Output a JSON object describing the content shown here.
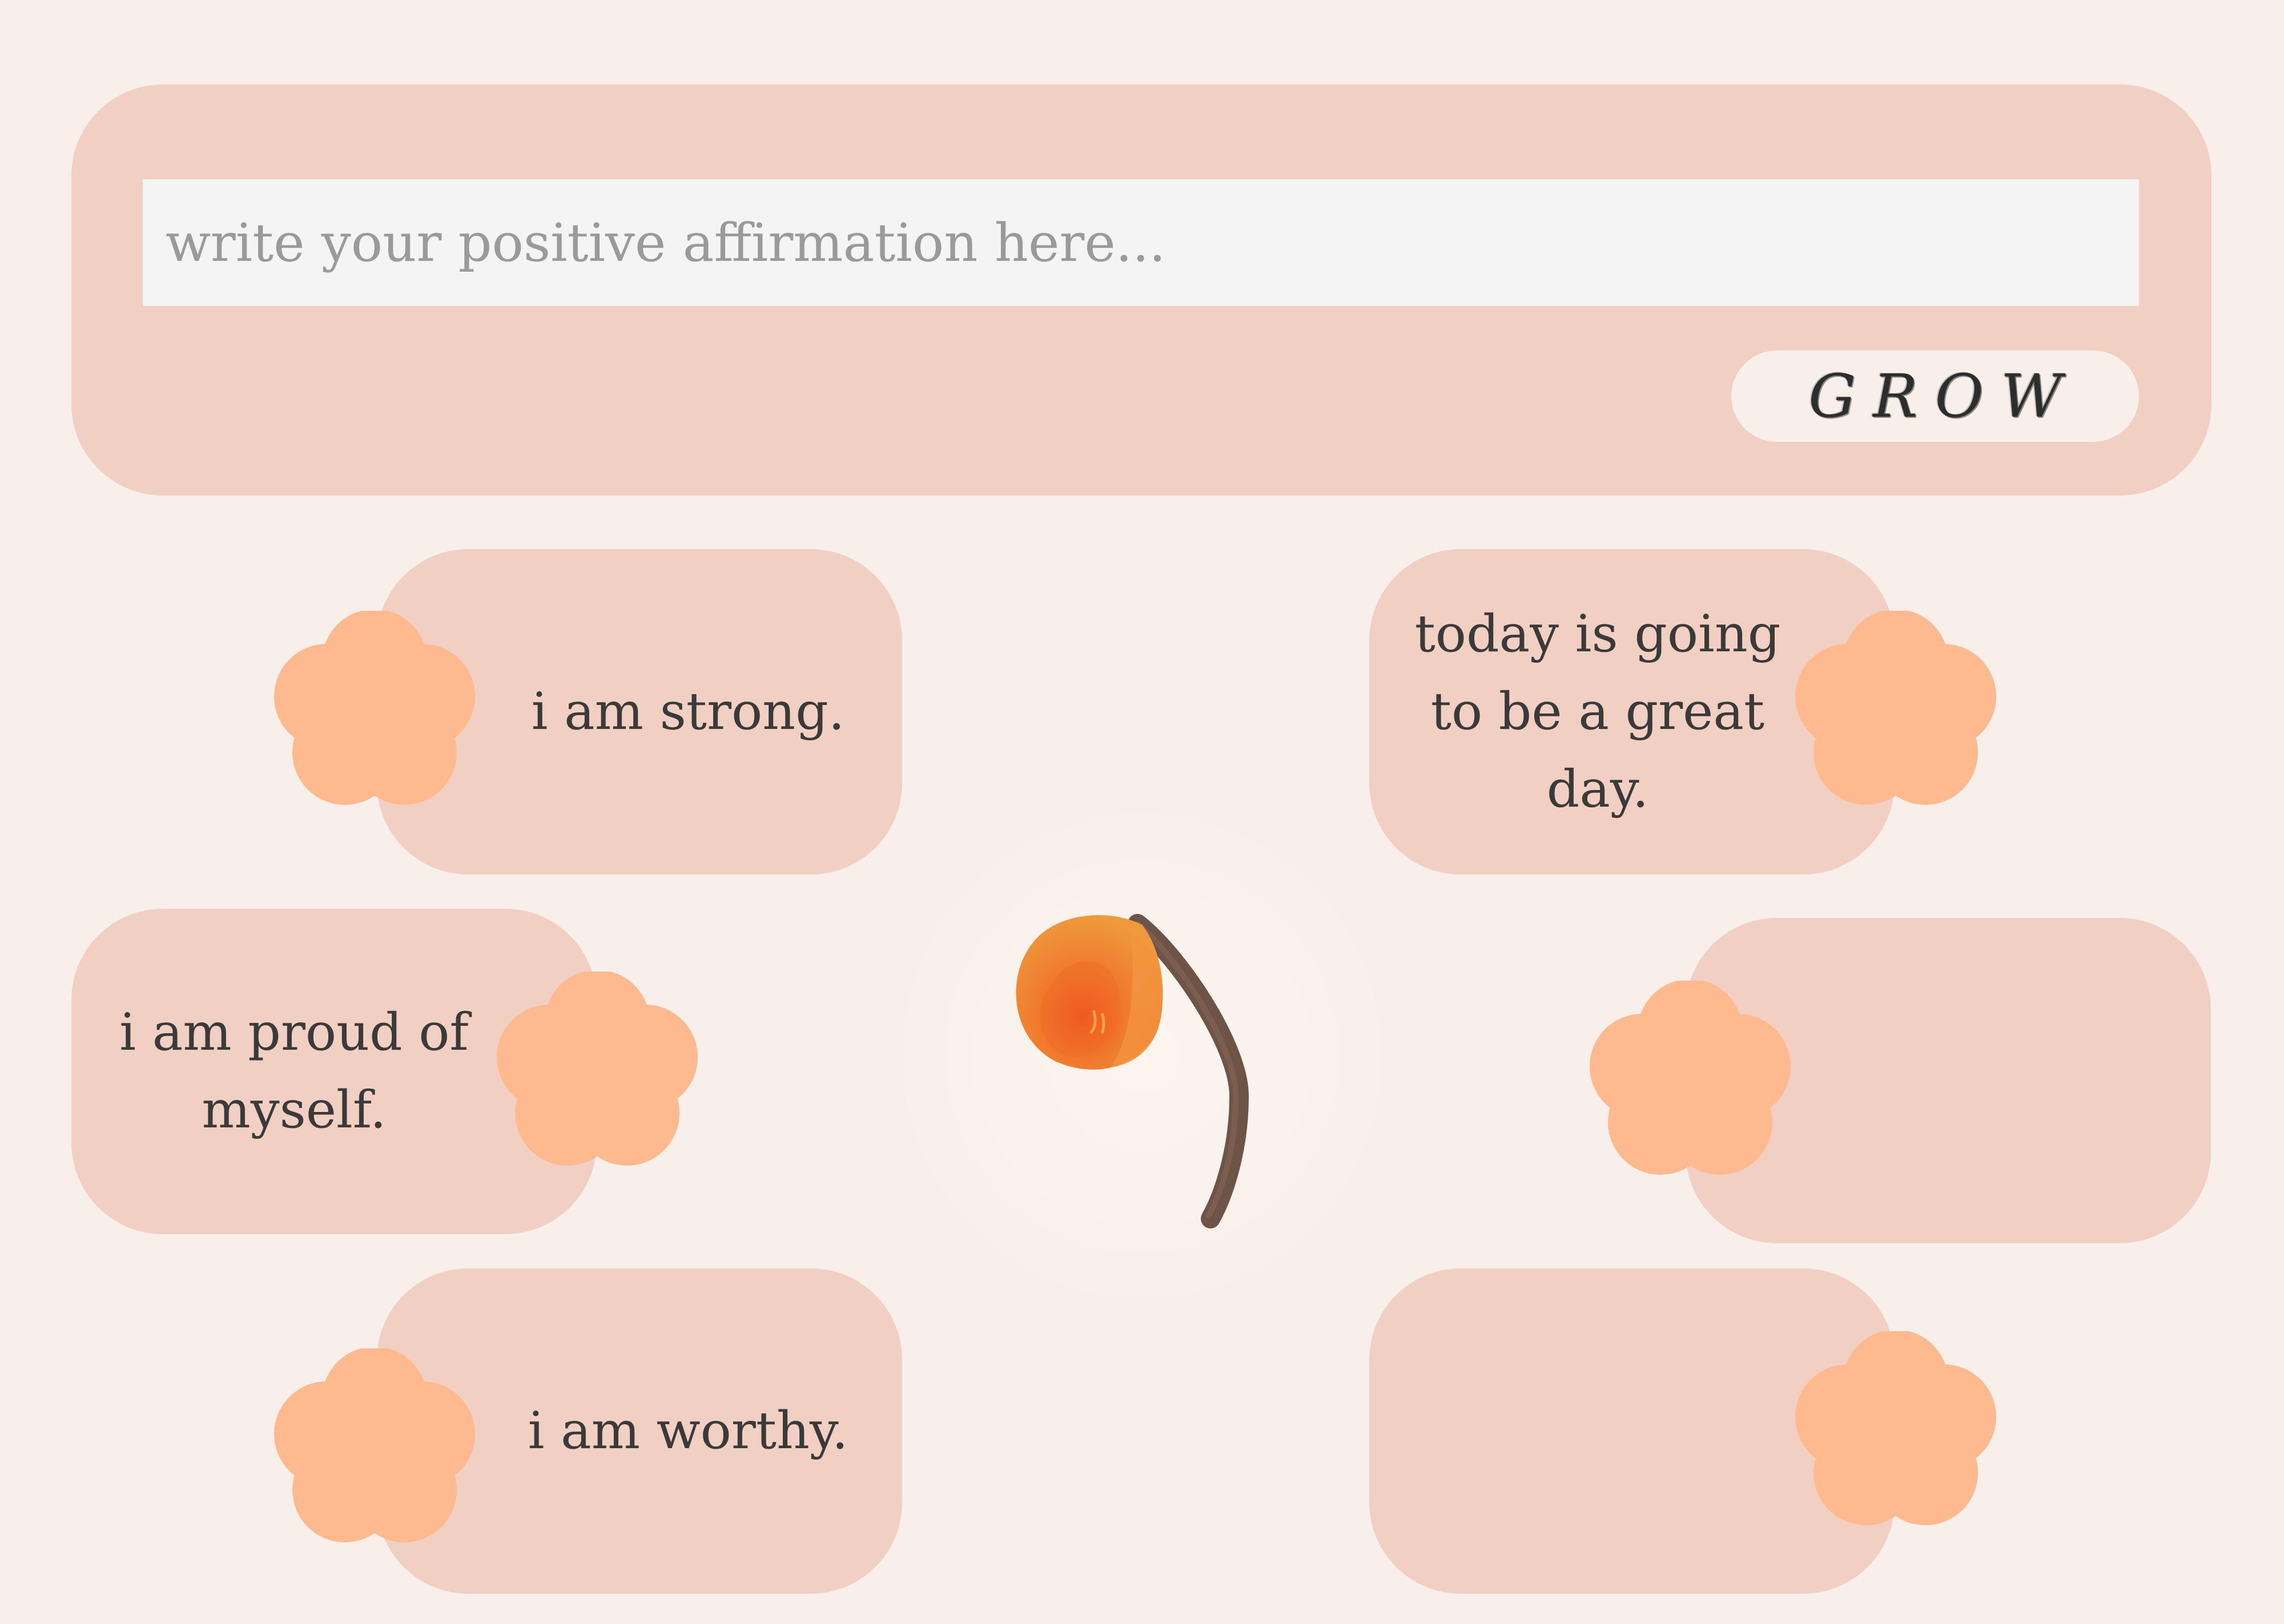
{
  "input": {
    "placeholder": "write your positive affirmation here...",
    "value": ""
  },
  "grow_button": {
    "label": "GROW"
  },
  "affirmations": [
    {
      "text": "i am strong."
    },
    {
      "text": "today is going to be a great day."
    },
    {
      "text": "i am proud of myself."
    },
    {
      "text": ""
    },
    {
      "text": "i am worthy."
    },
    {
      "text": ""
    }
  ],
  "colors": {
    "background": "#f9efea",
    "panel": "#f1cfc3",
    "flower": "#ffb98e",
    "input": "#f4f4f4",
    "bud": "#f07a2a",
    "stem": "#6e5347"
  },
  "icons": {
    "card_icon": "flower-icon",
    "center_image": "flower-bud-icon"
  }
}
